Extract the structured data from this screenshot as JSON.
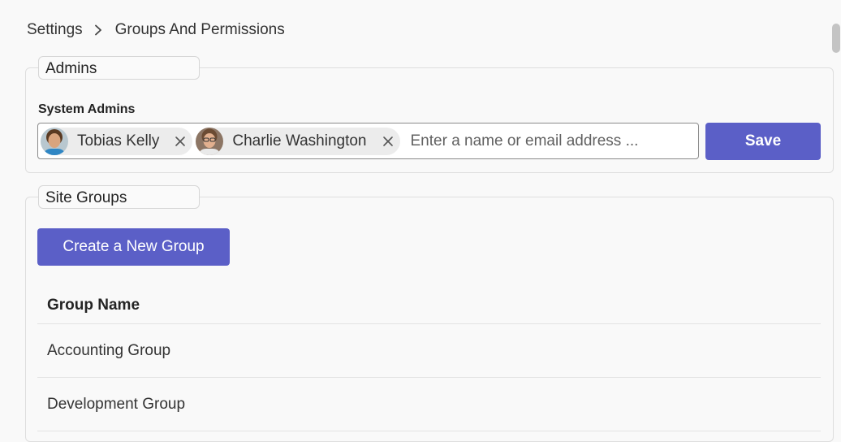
{
  "breadcrumb": {
    "root": "Settings",
    "current": "Groups And Permissions"
  },
  "admins": {
    "legend": "Admins",
    "field_label": "System Admins",
    "selected": [
      {
        "name": "Tobias Kelly"
      },
      {
        "name": "Charlie Washington"
      }
    ],
    "input_placeholder": "Enter a name or email address ...",
    "save_label": "Save"
  },
  "site_groups": {
    "legend": "Site Groups",
    "create_label": "Create a New Group",
    "column_header": "Group Name",
    "rows": [
      "Accounting Group",
      "Development Group"
    ]
  },
  "colors": {
    "primary": "#5b5fc7",
    "chip_bg": "#ececec",
    "border": "#dedede"
  },
  "icons": {
    "separator": "chevron-right-icon",
    "remove": "dismiss-icon"
  }
}
